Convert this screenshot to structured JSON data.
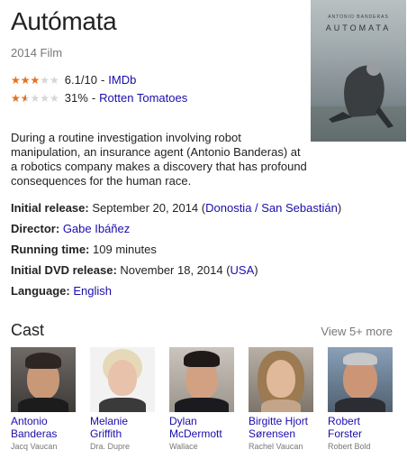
{
  "title": "Autómata",
  "subtitle": "2014 Film",
  "poster": {
    "actor_text": "ANTONIO BANDERAS",
    "title_text": "AUTOMATA"
  },
  "ratings": [
    {
      "score": "6.1/10",
      "source": "IMDb",
      "star_fraction": 0.61
    },
    {
      "score": "31%",
      "source": "Rotten Tomatoes",
      "star_fraction": 0.31
    }
  ],
  "description": "During a routine investigation involving robot manipulation, an insurance agent (Antonio Banderas) at a robotics company makes a discovery that has profound consequences for the human race.",
  "facts": {
    "release_label": "Initial release:",
    "release_value": "September 20, 2014",
    "release_link": "Donostia / San Sebastián",
    "director_label": "Director:",
    "director_link": "Gabe Ibáñez",
    "runtime_label": "Running time:",
    "runtime_value": "109 minutes",
    "dvd_label": "Initial DVD release:",
    "dvd_value": "November 18, 2014",
    "dvd_link": "USA",
    "language_label": "Language:",
    "language_link": "English"
  },
  "cast_heading": "Cast",
  "view_more": "View 5+ more",
  "cast": [
    {
      "name": "Antonio Banderas",
      "role": "Jacq Vaucan"
    },
    {
      "name": "Melanie Griffith",
      "role": "Dra. Dupre"
    },
    {
      "name": "Dylan McDermott",
      "role": "Wallace"
    },
    {
      "name": "Birgitte Hjort Sørensen",
      "role": "Rachel Vaucan"
    },
    {
      "name": "Robert Forster",
      "role": "Robert Bold"
    }
  ],
  "colors": {
    "link": "#1a0dab",
    "star": "#e7711b",
    "muted": "#777777"
  }
}
